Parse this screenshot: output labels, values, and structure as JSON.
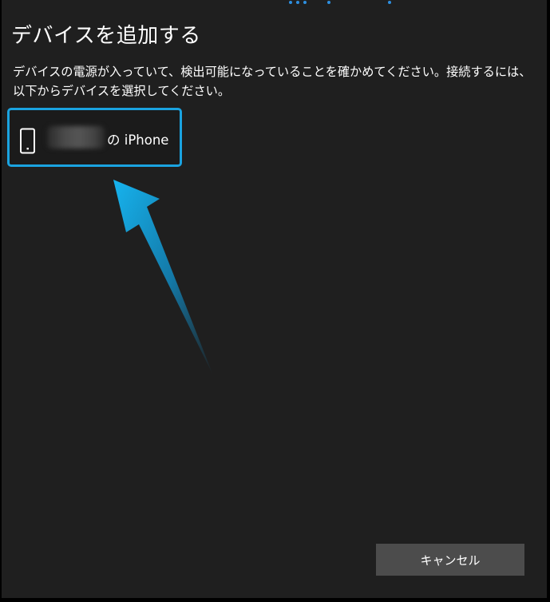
{
  "dialog": {
    "title": "デバイスを追加する",
    "description": "デバイスの電源が入っていて、検出可能になっていることを確かめてください。接続するには、以下からデバイスを選択してください。"
  },
  "devices": [
    {
      "name_suffix": "の iPhone",
      "icon": "phone-icon",
      "selected": true
    }
  ],
  "footer": {
    "cancel_label": "キャンセル"
  },
  "colors": {
    "background": "#1f1f1f",
    "accent": "#1aa3e0",
    "button": "#4c4c4c",
    "text": "#ffffff"
  }
}
